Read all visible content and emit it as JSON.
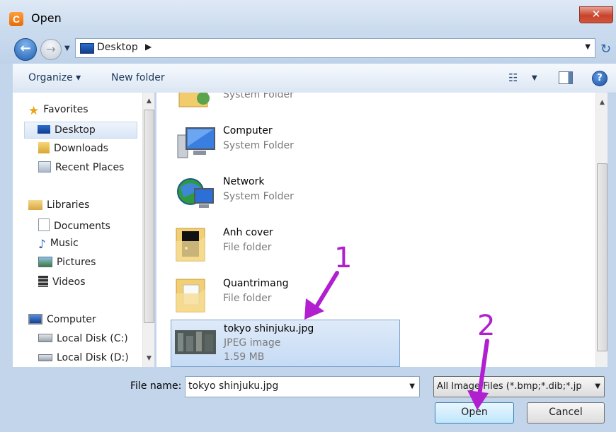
{
  "window": {
    "title": "Open",
    "app_icon_letter": "C",
    "close_symbol": "✕"
  },
  "address": {
    "location": "Desktop"
  },
  "toolbar": {
    "organize": "Organize ▾",
    "new_folder": "New folder"
  },
  "nav": {
    "favorites": "Favorites",
    "desktop": "Desktop",
    "downloads": "Downloads",
    "recent": "Recent Places",
    "libraries": "Libraries",
    "documents": "Documents",
    "music": "Music",
    "pictures": "Pictures",
    "videos": "Videos",
    "computer": "Computer",
    "disk_c": "Local Disk (C:)",
    "disk_d": "Local Disk (D:)"
  },
  "items": {
    "top_partial_type": "System Folder",
    "computer": {
      "name": "Computer",
      "type": "System Folder"
    },
    "network": {
      "name": "Network",
      "type": "System Folder"
    },
    "anh_cover": {
      "name": "Anh cover",
      "type": "File folder"
    },
    "quantrimang": {
      "name": "Quantrimang",
      "type": "File folder"
    },
    "tokyo": {
      "name": "tokyo shinjuku.jpg",
      "type": "JPEG image",
      "size": "1.59 MB"
    }
  },
  "footer": {
    "file_name_label": "File name:",
    "file_name_value": "tokyo shinjuku.jpg",
    "file_type": "All Image Files (*.bmp;*.dib;*.jp",
    "open_label": "Open",
    "cancel_label": "Cancel"
  },
  "annotations": {
    "step1": "1",
    "step2": "2"
  },
  "colors": {
    "annotation": "#b11fd0",
    "selection": "#c5dbf5"
  }
}
